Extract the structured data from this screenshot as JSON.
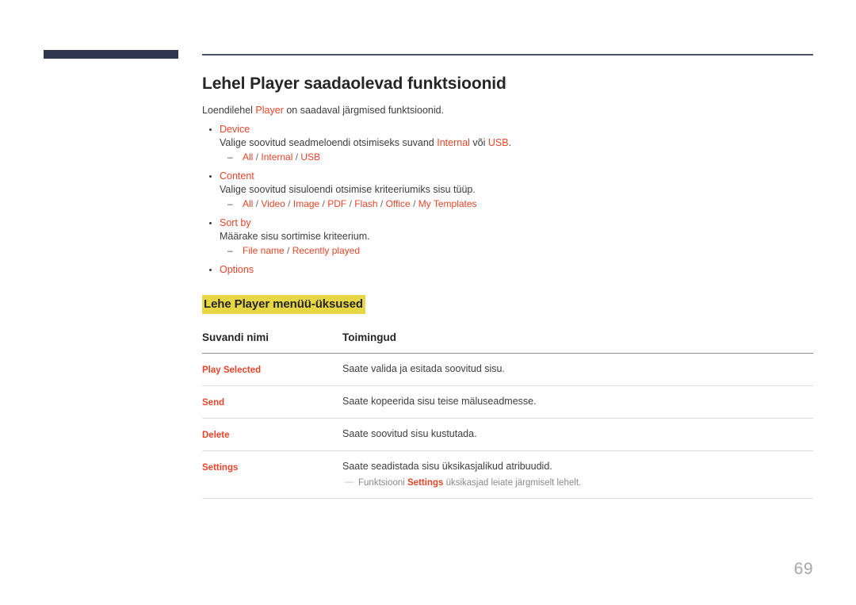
{
  "page": {
    "number": "69"
  },
  "header": {
    "left_bar_color": "#2e3650",
    "right_rule_color": "#4e5168"
  },
  "colors": {
    "accent": "#e8452a",
    "highlight": "#e7d745",
    "body_text": "#3d3d3d",
    "note_text": "#8a8a8a",
    "page_number": "#a6a6a6"
  },
  "title": "Lehel Player saadaolevad funktsioonid",
  "intro": {
    "before": "Loendilehel ",
    "accent": "Player",
    "after": " on saadaval järgmised funktsioonid."
  },
  "bullets": [
    {
      "name": "Device",
      "description": {
        "t1": "Valige soovitud seadmeloendi otsimiseks suvand ",
        "a1": "Internal",
        "t2": " või ",
        "a2": "USB",
        "t3": "."
      },
      "options": [
        "All",
        "Internal",
        "USB"
      ]
    },
    {
      "name": "Content",
      "description": {
        "t1": "Valige soovitud sisuloendi otsimise kriteeriumiks sisu tüüp.",
        "a1": "",
        "t2": "",
        "a2": "",
        "t3": ""
      },
      "options": [
        "All",
        "Video",
        "Image",
        "PDF",
        "Flash",
        "Office",
        "My Templates"
      ]
    },
    {
      "name": "Sort by",
      "description": {
        "t1": "Määrake sisu sortimise kriteerium.",
        "a1": "",
        "t2": "",
        "a2": "",
        "t3": ""
      },
      "options": [
        "File name",
        "Recently played"
      ]
    },
    {
      "name": "Options",
      "description": null,
      "options": []
    }
  ],
  "section_heading": "Lehe Player menüü-üksused",
  "table": {
    "headers": [
      "Suvandi nimi",
      "Toimingud"
    ],
    "rows": [
      {
        "name": "Play Selected",
        "action": "Saate valida ja esitada soovitud sisu.",
        "note": null
      },
      {
        "name": "Send",
        "action": "Saate kopeerida sisu teise mäluseadmesse.",
        "note": null
      },
      {
        "name": "Delete",
        "action": "Saate soovitud sisu kustutada.",
        "note": null
      },
      {
        "name": "Settings",
        "action": "Saate seadistada sisu üksikasjalikud atribuudid.",
        "note": {
          "before": "Funktsiooni ",
          "accent": "Settings",
          "after": " üksikasjad leiate järgmiselt lehelt."
        }
      }
    ]
  }
}
